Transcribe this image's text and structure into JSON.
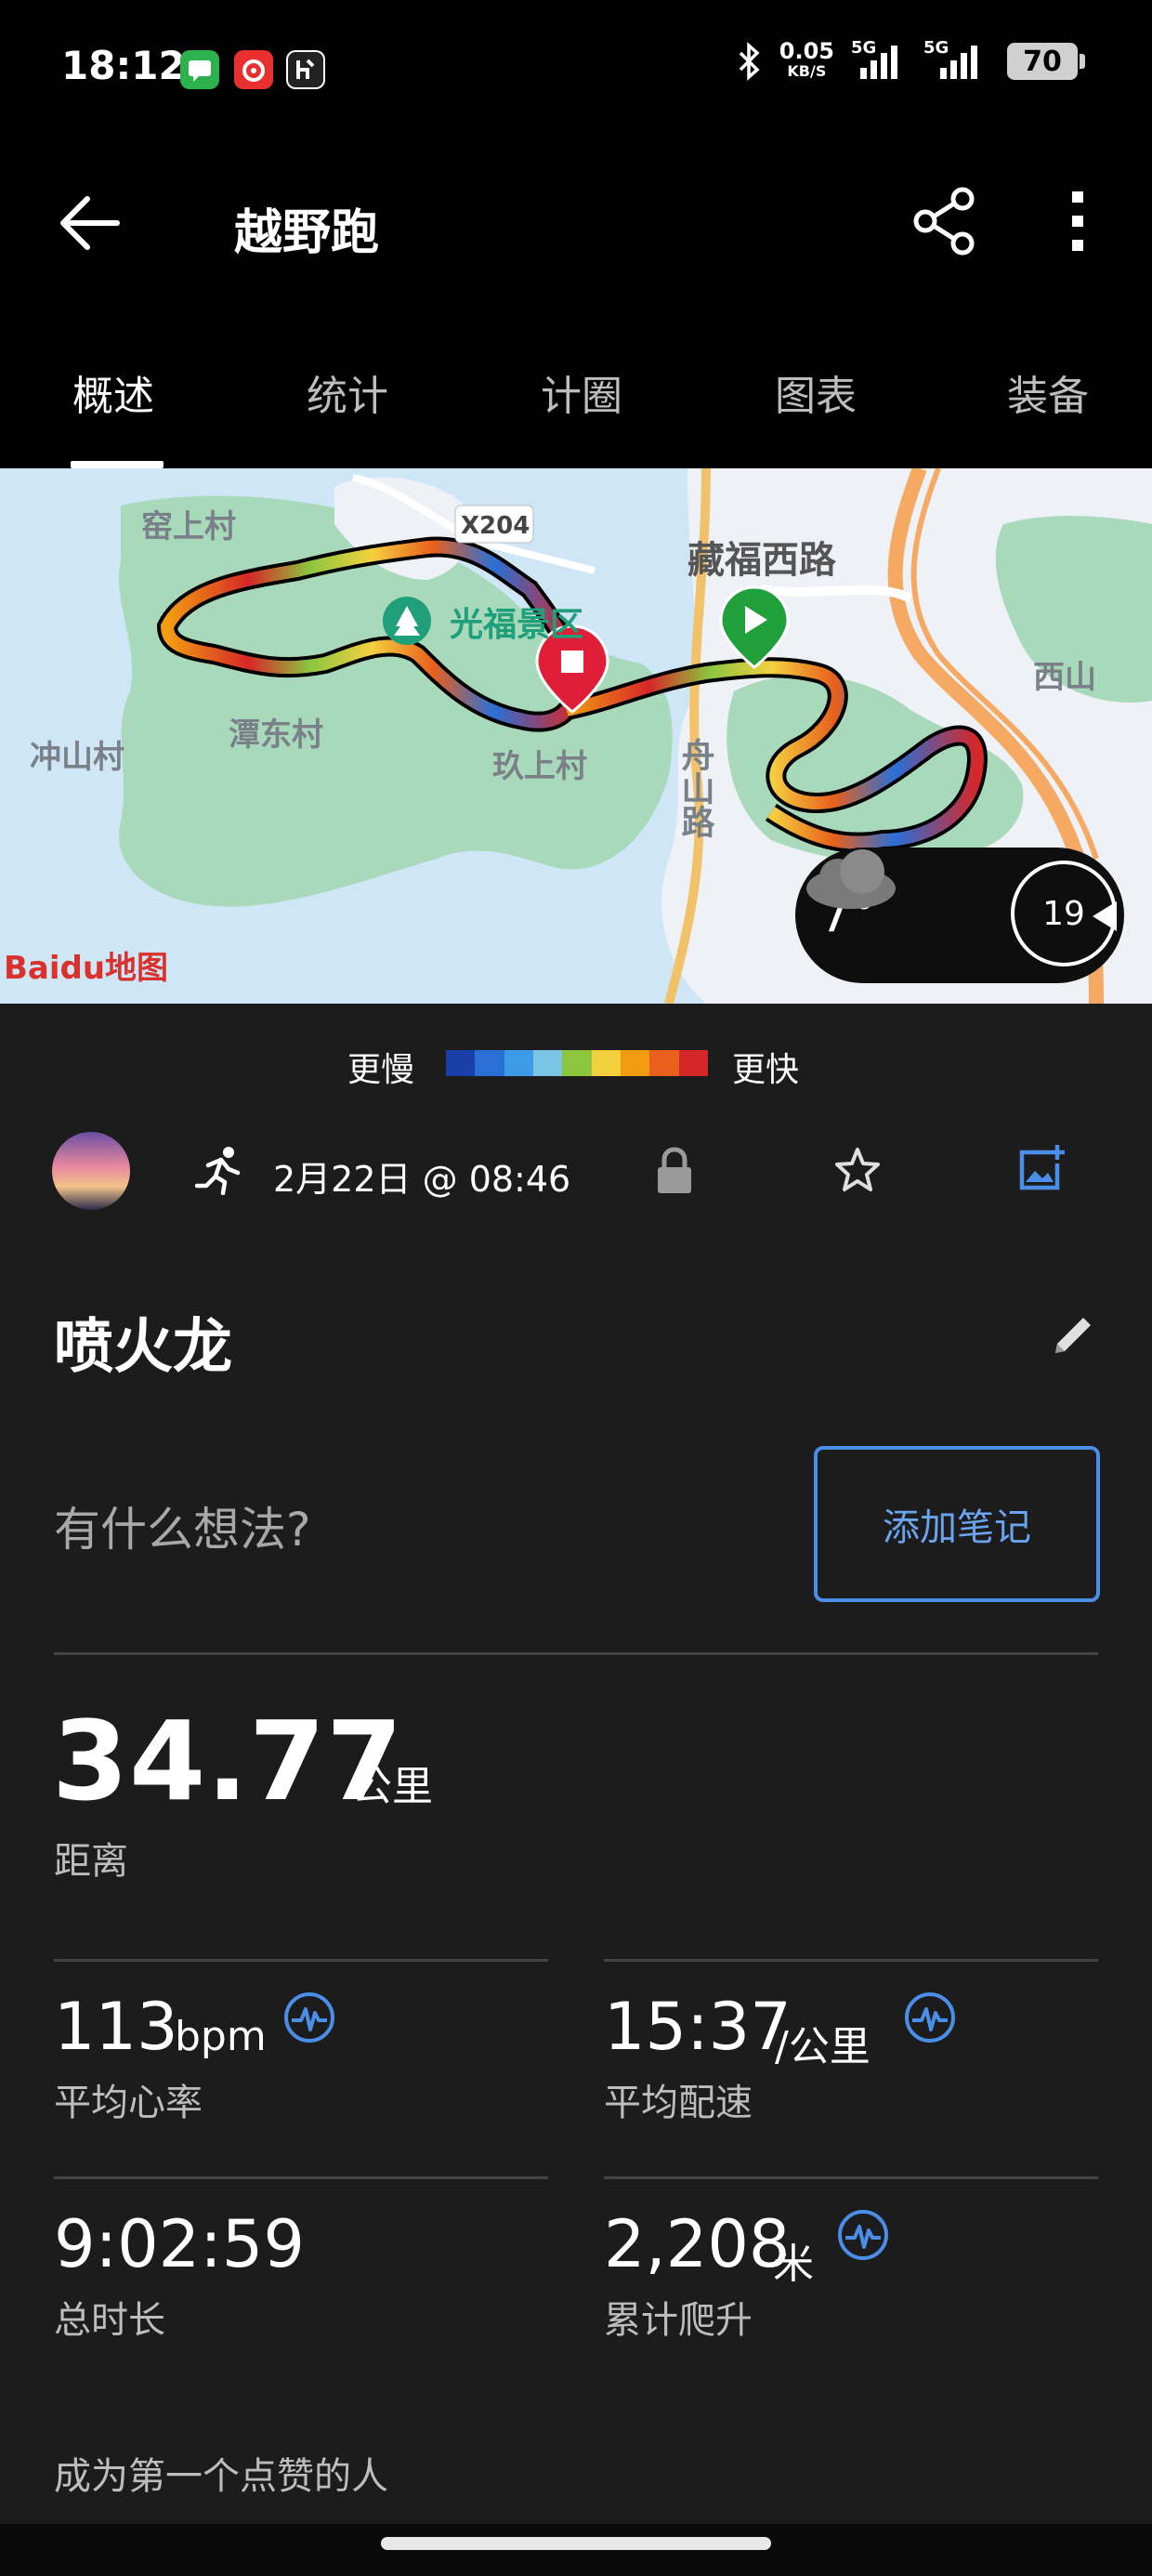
{
  "status_bar": {
    "time": "18:12",
    "net_speed_value": "0.05",
    "net_speed_unit": "KB/S",
    "network_1": "5G",
    "network_2": "5G",
    "battery": "70",
    "icons": [
      "message-app-icon",
      "netease-music-app-icon",
      "health-app-icon",
      "bluetooth-icon",
      "signal-icon",
      "signal-icon"
    ]
  },
  "app_bar": {
    "title": "越野跑",
    "icons": [
      "back-arrow-icon",
      "share-icon",
      "more-vert-icon"
    ]
  },
  "tabs": [
    {
      "label": "概述",
      "active": true
    },
    {
      "label": "统计",
      "active": false
    },
    {
      "label": "计圈",
      "active": false
    },
    {
      "label": "图表",
      "active": false
    },
    {
      "label": "装备",
      "active": false
    }
  ],
  "map": {
    "labels": {
      "village_1": "窑上村",
      "road": "X204",
      "scenic": "光福景区",
      "street": "藏福西路",
      "mountain": "西山",
      "village_2": "潭东村",
      "village_3": "冲山村",
      "village_4": "玖上村",
      "road_2": "舟山路"
    },
    "weather_temp": "7°",
    "wind_speed": "19",
    "attribution": "Baidu地图"
  },
  "legend": {
    "slow_label": "更慢",
    "fast_label": "更快",
    "colors": [
      "#1a3fa8",
      "#2a6fd6",
      "#3b9be6",
      "#7ac4e8",
      "#8cc63f",
      "#f4d03f",
      "#f39c12",
      "#e8601c",
      "#d62728"
    ]
  },
  "activity": {
    "date_time": "2月22日 @ 08:46",
    "name": "喷火龙",
    "note_placeholder": "有什么想法?",
    "add_note_label": "添加笔记"
  },
  "stats": {
    "distance": {
      "value": "34.77",
      "unit": "公里",
      "label": "距离"
    },
    "avg_hr": {
      "value": "113",
      "unit": "bpm",
      "label": "平均心率"
    },
    "avg_pace": {
      "value": "15:37",
      "unit": "/公里",
      "label": "平均配速"
    },
    "total_time": {
      "value": "9:02:59",
      "label": "总时长"
    },
    "elevation_gain": {
      "value": "2,208",
      "unit": "米",
      "label": "累计爬升"
    }
  },
  "social": {
    "like_prompt": "成为第一个点赞的人"
  },
  "colors": {
    "accent": "#4a8ee8",
    "start_marker": "#1fa03a",
    "end_marker": "#e01e37"
  }
}
